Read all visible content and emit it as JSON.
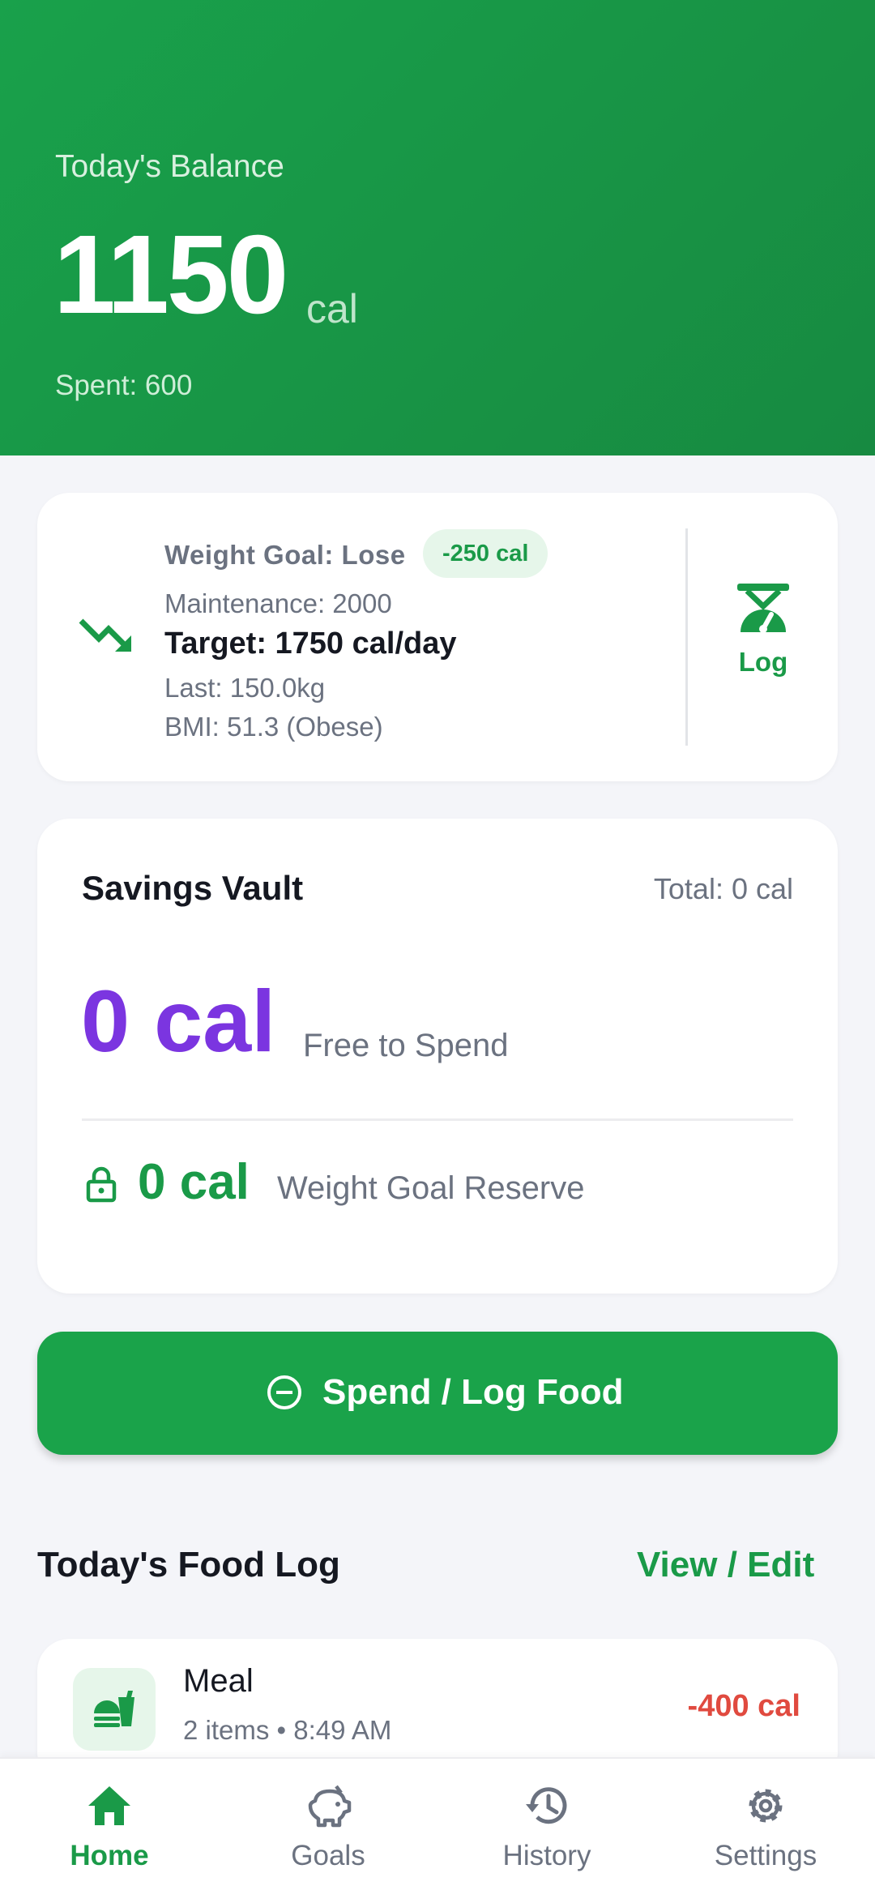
{
  "balance": {
    "label": "Today's Balance",
    "amount": "1150",
    "unit": "cal",
    "spent": "Spent: 600"
  },
  "weight_goal": {
    "title": "Weight Goal: Lose",
    "badge": "-250 cal",
    "maintenance": "Maintenance: 2000",
    "target": "Target: 1750 cal/day",
    "last": "Last: 150.0kg",
    "bmi": "BMI: 51.3 (Obese)",
    "log_label": "Log",
    "trend_icon": "trending-down-icon",
    "log_icon": "scale-icon"
  },
  "vault": {
    "title": "Savings Vault",
    "total": "Total: 0 cal",
    "free_amount": "0 cal",
    "free_label": "Free to Spend",
    "reserve_amount": "0 cal",
    "reserve_label": "Weight Goal Reserve",
    "lock_icon": "lock-icon"
  },
  "spend_button": {
    "label": "Spend / Log Food",
    "icon": "minus-circle-icon"
  },
  "food_log": {
    "title": "Today's Food Log",
    "view_edit": "View / Edit",
    "entries": [
      {
        "name": "Meal",
        "meta": "2 items • 8:49 AM",
        "calories": "-400 cal",
        "icon": "food-icon"
      }
    ]
  },
  "nav": {
    "items": [
      {
        "label": "Home",
        "icon": "home-icon",
        "active": true
      },
      {
        "label": "Goals",
        "icon": "piggy-bank-icon",
        "active": false
      },
      {
        "label": "History",
        "icon": "history-icon",
        "active": false
      },
      {
        "label": "Settings",
        "icon": "gear-icon",
        "active": false
      }
    ]
  },
  "colors": {
    "primary_green": "#1aa34a",
    "vault_purple": "#7b35e0",
    "negative_red": "#e04a3f",
    "background": "#f4f5f9"
  }
}
